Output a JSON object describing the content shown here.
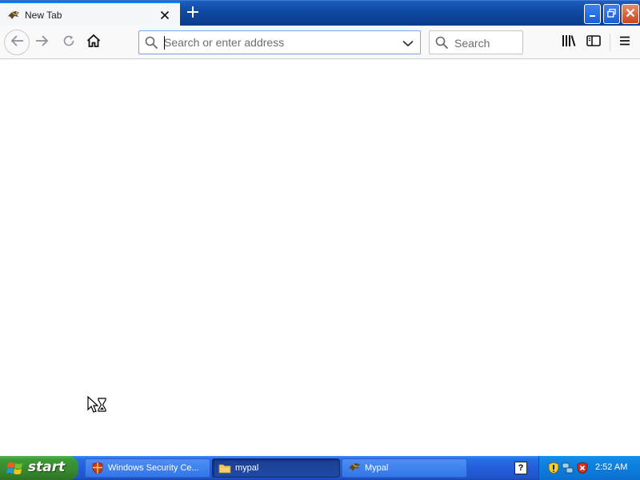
{
  "browser": {
    "tab": {
      "title": "New Tab",
      "favicon": "mypal-icon",
      "close_icon": "close-icon"
    },
    "new_tab_icon": "plus-icon",
    "window_controls": {
      "minimize": "minimize-icon",
      "maximize": "restore-icon",
      "close": "close-icon"
    },
    "toolbar": {
      "back_icon": "back-arrow-icon",
      "forward_icon": "forward-arrow-icon",
      "reload_icon": "reload-icon",
      "home_icon": "home-icon",
      "url_placeholder": "Search or enter address",
      "url_value": "",
      "search_placeholder": "Search",
      "library_icon": "library-icon",
      "sidebar_icon": "sidebar-icon",
      "menu_icon": "hamburger-menu-icon"
    }
  },
  "taskbar": {
    "start_label": "start",
    "items": [
      {
        "label": "Windows Security Ce...",
        "icon": "security-shield-icon",
        "active": false
      },
      {
        "label": "mypal",
        "icon": "folder-icon",
        "active": true
      },
      {
        "label": "Mypal",
        "icon": "mypal-icon",
        "active": false
      }
    ],
    "help_icon_label": "?",
    "tray_icons": [
      "security-alert-icon",
      "network-icon",
      "shield-alert-icon"
    ],
    "clock": "2:52 AM"
  },
  "colors": {
    "tab_accent": "#0a84ff",
    "taskbar_blue": "#245edb",
    "start_green": "#3c9a34",
    "tray_blue": "#0d80df",
    "close_red": "#c8461f"
  }
}
